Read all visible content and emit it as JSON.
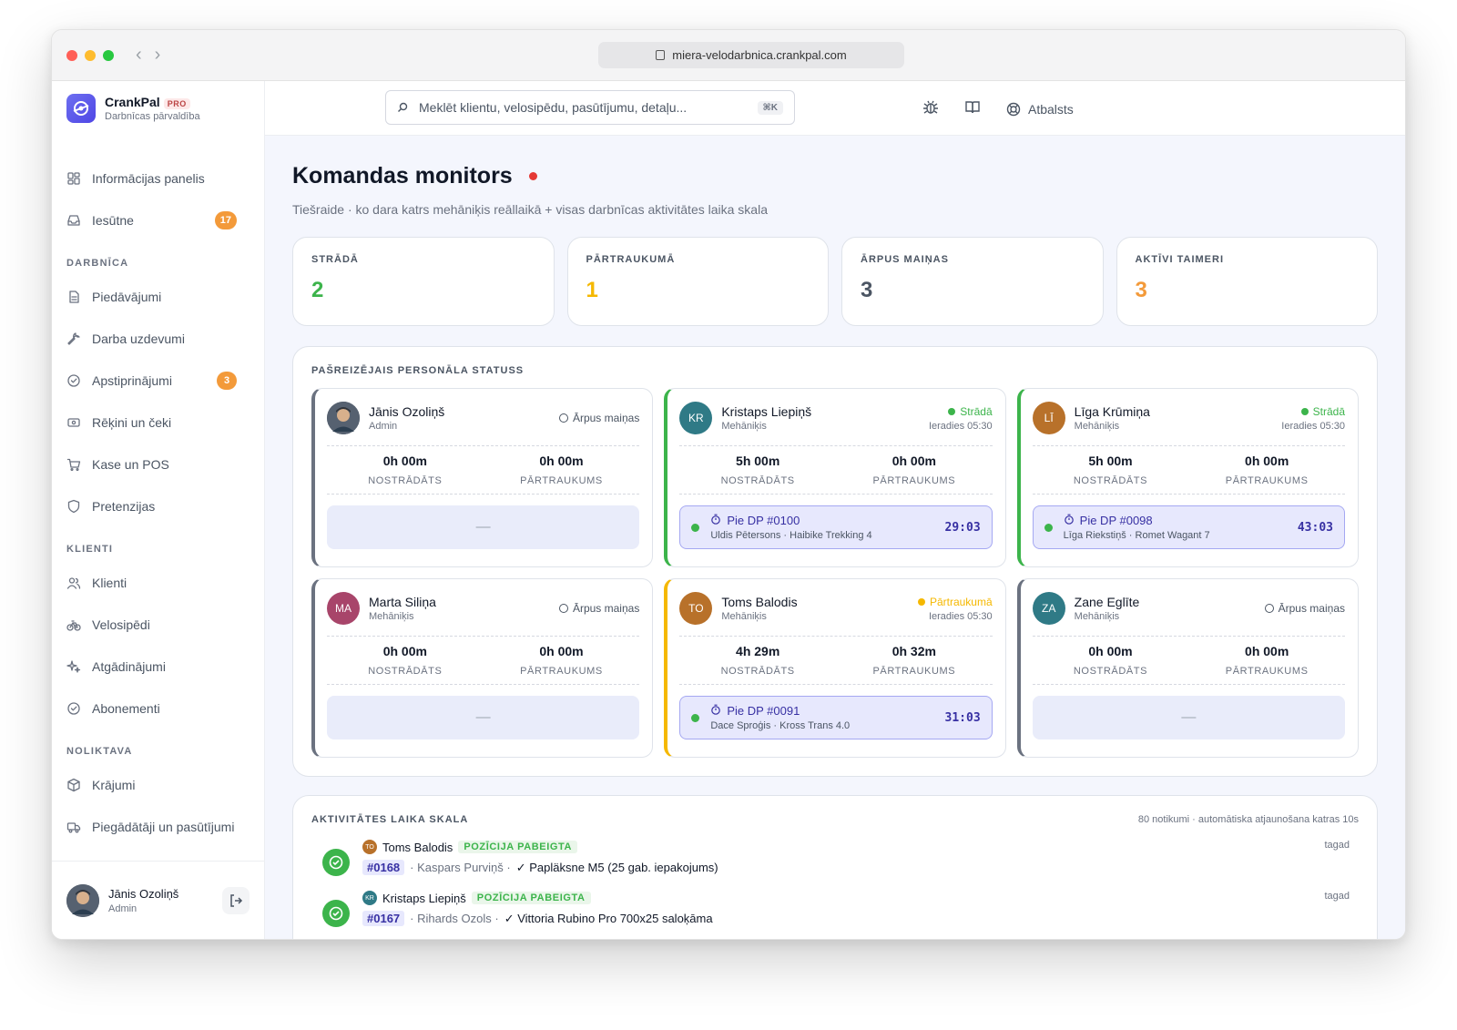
{
  "browser": {
    "url": "miera-velodarbnica.crankpal.com"
  },
  "brand": {
    "name": "CrankPal",
    "badge": "PRO",
    "subtitle": "Darbnīcas pārvaldība"
  },
  "search": {
    "placeholder": "Meklēt klientu, velosipēdu, pasūtījumu, detaļu...",
    "shortcut": "⌘K"
  },
  "topbar": {
    "support_label": "Atbalsts"
  },
  "sidebar": {
    "top_items": [
      {
        "label": "Informācijas panelis",
        "icon": "dashboard-icon"
      },
      {
        "label": "Iesūtne",
        "icon": "inbox-icon",
        "badge": "17"
      }
    ],
    "sections": [
      {
        "title": "DARBNĪCA",
        "items": [
          {
            "label": "Piedāvājumi",
            "icon": "document-icon"
          },
          {
            "label": "Darba uzdevumi",
            "icon": "wrench-icon"
          },
          {
            "label": "Apstiprinājumi",
            "icon": "check-circle-icon",
            "badge": "3"
          },
          {
            "label": "Rēķini un čeki",
            "icon": "receipt-icon"
          },
          {
            "label": "Kase un POS",
            "icon": "cart-icon"
          },
          {
            "label": "Pretenzijas",
            "icon": "shield-icon"
          }
        ]
      },
      {
        "title": "KLIENTI",
        "items": [
          {
            "label": "Klienti",
            "icon": "users-icon"
          },
          {
            "label": "Velosipēdi",
            "icon": "bicycle-icon"
          },
          {
            "label": "Atgādinājumi",
            "icon": "sparkle-icon"
          },
          {
            "label": "Abonementi",
            "icon": "check-circle-icon"
          }
        ]
      },
      {
        "title": "NOLIKTAVA",
        "items": [
          {
            "label": "Krājumi",
            "icon": "box-icon"
          },
          {
            "label": "Piegādātāji un pasūtījumi",
            "icon": "truck-icon"
          }
        ]
      }
    ],
    "user": {
      "name": "Jānis Ozoliņš",
      "role": "Admin"
    }
  },
  "page": {
    "title": "Komandas monitors",
    "subtitle": "Tiešraide · ko dara katrs mehāniķis reāllaikā + visas darbnīcas aktivitātes laika skala"
  },
  "stats": [
    {
      "label": "STRĀDĀ",
      "value": "2",
      "color": "#3cb44b"
    },
    {
      "label": "PĀRTRAUKUMĀ",
      "value": "1",
      "color": "#f5b800"
    },
    {
      "label": "ĀRPUS MAIŅAS",
      "value": "3",
      "color": "#4b5563"
    },
    {
      "label": "AKTĪVI TAIMERI",
      "value": "3",
      "color": "#f39a3a"
    }
  ],
  "staff_panel": {
    "title": "PAŠREIZĒJAIS PERSONĀLA STATUSS",
    "worked_label": "NOSTRĀDĀTS",
    "break_label": "PĀRTRAUKUMS",
    "staff": [
      {
        "name": "Jānis Ozoliņš",
        "role": "Admin",
        "initials": "",
        "avatar_color": "#5b6470",
        "photo": true,
        "status": "Ārpus maiņas",
        "status_kind": "off",
        "arrived": "",
        "worked": "0h 00m",
        "break": "0h 00m",
        "job": null,
        "accent": "#6b7280"
      },
      {
        "name": "Kristaps Liepiņš",
        "role": "Mehāniķis",
        "initials": "KR",
        "avatar_color": "#2f7a86",
        "status": "Strādā",
        "status_kind": "working",
        "arrived": "Ieradies 05:30",
        "worked": "5h 00m",
        "break": "0h 00m",
        "job": {
          "title": "Pie DP #0100",
          "sub": "Uldis Pētersons · Haibike Trekking 4",
          "time": "29:03"
        },
        "accent": "#3cb44b"
      },
      {
        "name": "Līga Krūmiņa",
        "role": "Mehāniķis",
        "initials": "LĪ",
        "avatar_color": "#b8712a",
        "status": "Strādā",
        "status_kind": "working",
        "arrived": "Ieradies 05:30",
        "worked": "5h 00m",
        "break": "0h 00m",
        "job": {
          "title": "Pie DP #0098",
          "sub": "Līga Riekstiņš · Romet Wagant 7",
          "time": "43:03"
        },
        "accent": "#3cb44b"
      },
      {
        "name": "Marta Siliņa",
        "role": "Mehāniķis",
        "initials": "MA",
        "avatar_color": "#a8456a",
        "status": "Ārpus maiņas",
        "status_kind": "off",
        "arrived": "",
        "worked": "0h 00m",
        "break": "0h 00m",
        "job": null,
        "accent": "#6b7280"
      },
      {
        "name": "Toms Balodis",
        "role": "Mehāniķis",
        "initials": "TO",
        "avatar_color": "#b8712a",
        "status": "Pārtraukumā",
        "status_kind": "break",
        "arrived": "Ieradies 05:30",
        "worked": "4h 29m",
        "break": "0h 32m",
        "job": {
          "title": "Pie DP #0091",
          "sub": "Dace Sproģis · Kross Trans 4.0",
          "time": "31:03"
        },
        "accent": "#f5b800"
      },
      {
        "name": "Zane Eglīte",
        "role": "Mehāniķis",
        "initials": "ZA",
        "avatar_color": "#2f7a86",
        "status": "Ārpus maiņas",
        "status_kind": "off",
        "arrived": "",
        "worked": "0h 00m",
        "break": "0h 00m",
        "job": null,
        "accent": "#6b7280"
      }
    ],
    "empty_job": "—"
  },
  "timeline": {
    "title": "AKTIVITĀTES LAIKA SKALA",
    "meta": "80 notikumi · automātiska atjaunošana katras 10s",
    "events": [
      {
        "initials": "TO",
        "avatar_color": "#b8712a",
        "name": "Toms Balodis",
        "tag": "POZĪCIJA PABEIGTA",
        "order": "#0168",
        "customer": "Kaspars Purviņš",
        "text": "✓ Papläksne M5 (25 gab. iepakojums)",
        "time": "tagad"
      },
      {
        "initials": "KR",
        "avatar_color": "#2f7a86",
        "name": "Kristaps Liepiņš",
        "tag": "POZĪCIJA PABEIGTA",
        "order": "#0167",
        "customer": "Rihards Ozols",
        "text": "✓ Vittoria Rubino Pro 700x25 saloķāma",
        "time": "tagad"
      }
    ]
  }
}
